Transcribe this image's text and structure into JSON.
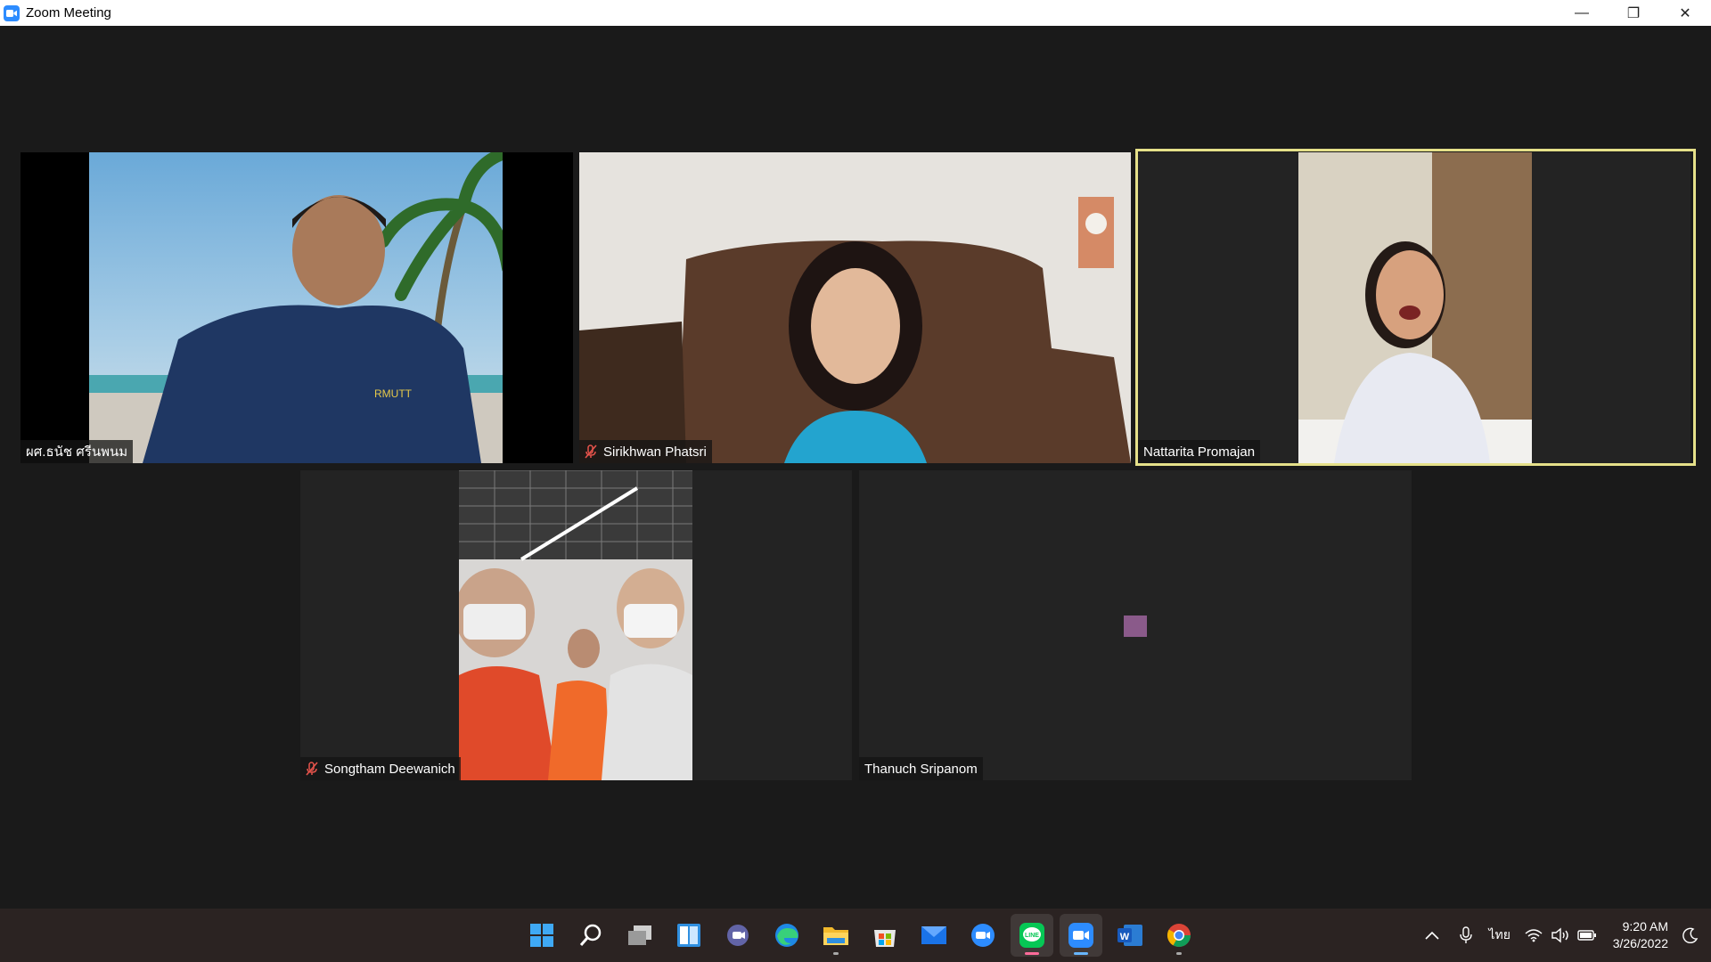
{
  "window": {
    "title": "Zoom Meeting",
    "controls": {
      "minimize": "—",
      "restore": "❐",
      "close": "✕"
    }
  },
  "participants": [
    {
      "name": "ผศ.ธนัช  ศรีนพนม",
      "muted": false,
      "active": false
    },
    {
      "name": "Sirikhwan Phatsri",
      "muted": true,
      "active": false
    },
    {
      "name": "Nattarita Promajan",
      "muted": false,
      "active": true
    },
    {
      "name": "Songtham Deewanich",
      "muted": true,
      "active": false
    },
    {
      "name": "Thanuch Sripanom",
      "muted": false,
      "active": false,
      "video_off": true
    }
  ],
  "colors": {
    "active_speaker_border": "#e5e089",
    "avatar_placeholder": "#8a5a8a",
    "zoom_blue": "#2d8cff"
  },
  "taskbar": {
    "apps": [
      {
        "name": "start-icon"
      },
      {
        "name": "search-icon"
      },
      {
        "name": "task-view-icon"
      },
      {
        "name": "widgets-icon"
      },
      {
        "name": "teams-chat-icon"
      },
      {
        "name": "edge-icon"
      },
      {
        "name": "file-explorer-icon"
      },
      {
        "name": "microsoft-store-icon"
      },
      {
        "name": "mail-icon"
      },
      {
        "name": "zoom-icon"
      },
      {
        "name": "line-icon"
      },
      {
        "name": "zoom-meeting-icon"
      },
      {
        "name": "word-icon"
      },
      {
        "name": "chrome-icon"
      }
    ],
    "tray": {
      "language": "ไทย",
      "time": "9:20 AM",
      "date": "3/26/2022"
    }
  }
}
